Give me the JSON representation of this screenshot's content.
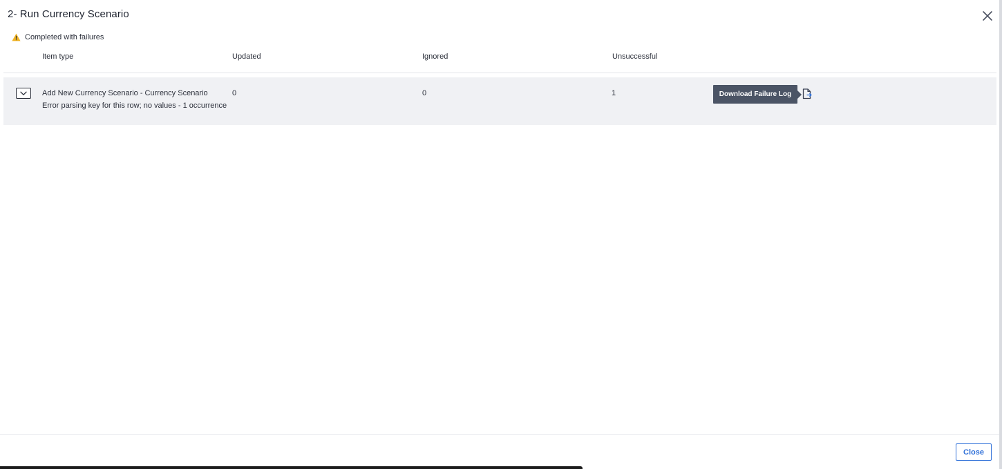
{
  "dialog": {
    "title": "2- Run Currency Scenario",
    "close_icon": "close-icon"
  },
  "status": {
    "icon": "warning-icon",
    "icon_color": "#f0b323",
    "text": "Completed with failures"
  },
  "table": {
    "columns": [
      "Item type",
      "Updated",
      "Ignored",
      "Unsuccessful"
    ],
    "rows": [
      {
        "item_type": "Add New Currency Scenario - Currency Scenario",
        "detail": "Error parsing key for this row; no values - 1 occurrence",
        "updated": "0",
        "ignored": "0",
        "unsuccessful": "1",
        "tooltip": "Download Failure Log",
        "action_icon": "download-file-icon",
        "expander_icon": "chevron-down-icon"
      }
    ]
  },
  "footer": {
    "close_label": "Close"
  },
  "colors": {
    "accent": "#2e6fd8",
    "tooltip_bg": "#4b5465",
    "row_bg": "#f0f1f4"
  }
}
